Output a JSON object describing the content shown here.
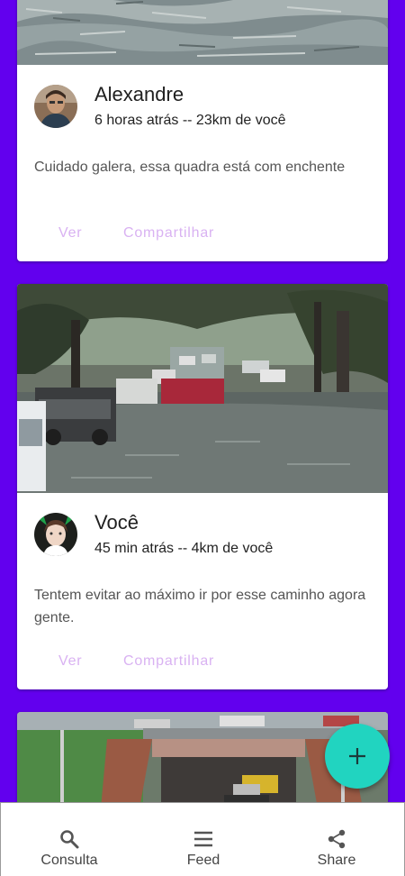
{
  "colors": {
    "background": "#6200ee",
    "card": "#ffffff",
    "action_text": "#d9b2f2",
    "fab": "#21d4c0"
  },
  "posts": [
    {
      "author": "Alexandre",
      "meta": "6 horas atrás -- 23km de você",
      "message": "Cuidado galera, essa quadra está com enchente",
      "actions": {
        "view": "Ver",
        "share": "Compartilhar"
      }
    },
    {
      "author": "Você",
      "meta": "45 min atrás -- 4km de você",
      "message": "Tentem evitar ao máximo ir por esse caminho agora gente.",
      "actions": {
        "view": "Ver",
        "share": "Compartilhar"
      }
    },
    {
      "author": "",
      "meta": "",
      "message": "",
      "actions": {
        "view": "",
        "share": ""
      }
    }
  ],
  "fab": {
    "icon": "plus-icon"
  },
  "bottom_nav": {
    "items": [
      {
        "label": "Consulta",
        "icon": "search-icon"
      },
      {
        "label": "Feed",
        "icon": "menu-icon"
      },
      {
        "label": "Share",
        "icon": "share-icon"
      }
    ]
  }
}
